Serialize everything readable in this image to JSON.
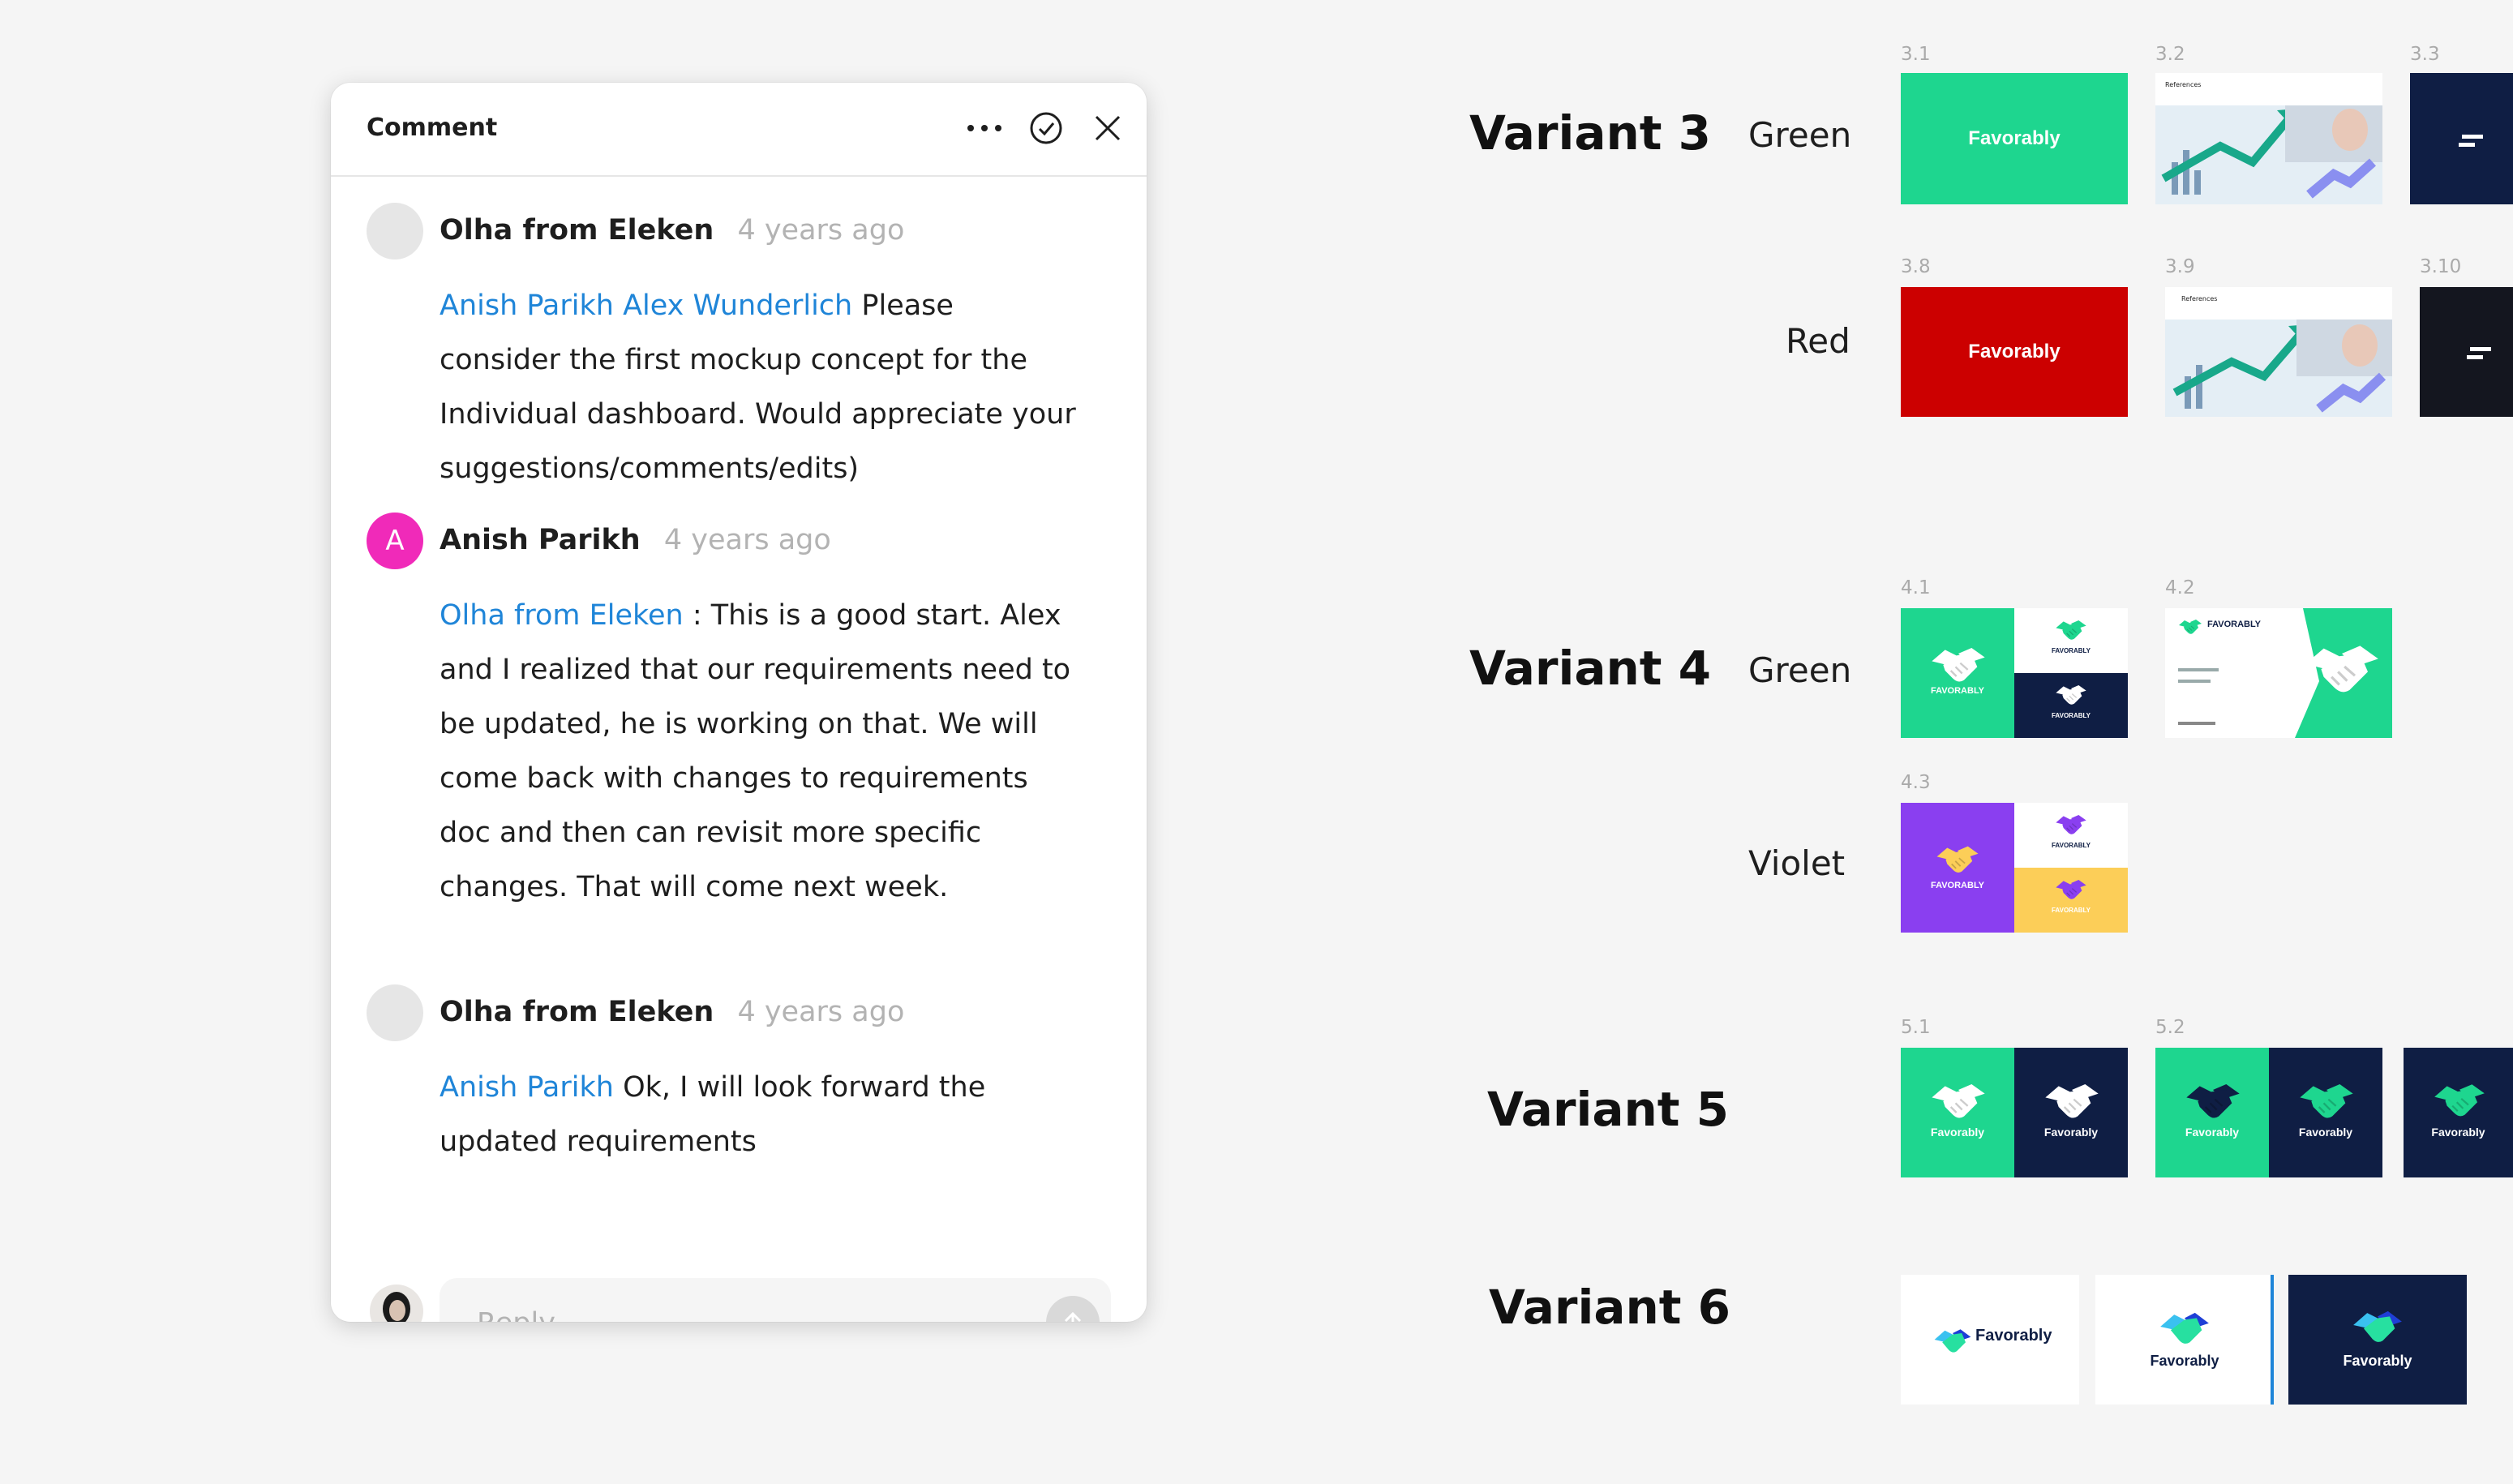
{
  "panel": {
    "title": "Comment",
    "comments": [
      {
        "author": "Olha from Eleken",
        "time": "4 years ago",
        "mentions": "Anish Parikh Alex Wunderlich",
        "text": "Please consider the first mockup concept for the Individual dashboard. Would appreciate your suggestions/comments/edits)"
      },
      {
        "author": "Anish Parikh",
        "avatar_initial": "A",
        "time": "4 years ago",
        "mentions": "Olha from Eleken",
        "text": ": This is a good start. Alex and I realized that our requirements need to be updated, he is working on that. We will come back with changes to requirements doc and then can revisit more specific changes.  That will come next week."
      },
      {
        "author": "Olha from Eleken",
        "time": "4 years ago",
        "mentions": "Anish Parikh",
        "text": "Ok, I will look forward the updated requirements"
      }
    ],
    "reply": {
      "placeholder": "Reply"
    }
  },
  "board": {
    "variants": [
      {
        "title": "Variant 3",
        "colors": [
          "Green",
          "Red"
        ],
        "thumbs": [
          "3.1",
          "3.2",
          "3.3",
          "3.8",
          "3.9",
          "3.10"
        ]
      },
      {
        "title": "Variant 4",
        "colors": [
          "Green",
          "Violet"
        ],
        "thumbs": [
          "4.1",
          "4.2",
          "4.3"
        ]
      },
      {
        "title": "Variant 5",
        "thumbs": [
          "5.1",
          "5.2"
        ]
      },
      {
        "title": "Variant 6"
      }
    ],
    "brand": "Favorably",
    "brand_caps": "FAVORABLY",
    "slide_heading": "References"
  },
  "colors": {
    "green": "#1ed68f",
    "red": "#cc0000",
    "navy": "#0f1e44",
    "dark": "#14161f",
    "violet": "#8a3ff0",
    "yellow": "#fcce58",
    "mention": "#1f85d8",
    "pink_avatar": "#f02ab9"
  }
}
